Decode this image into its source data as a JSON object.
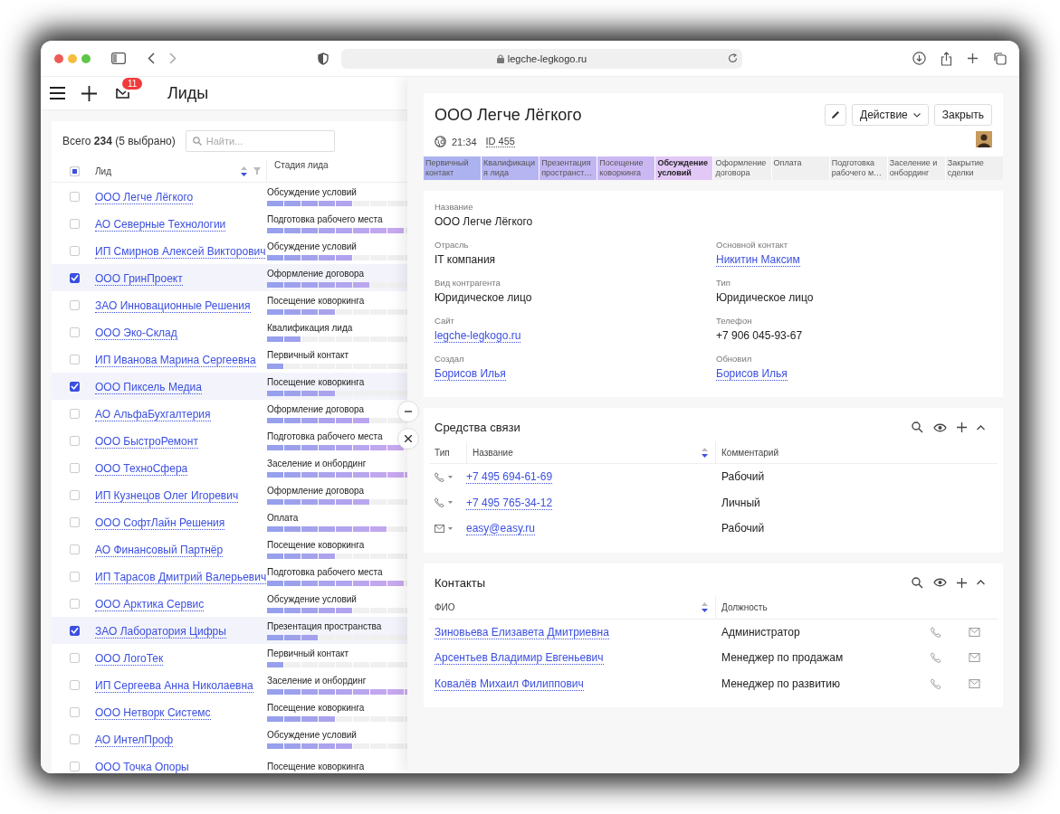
{
  "browser": {
    "url": "legche-legkogo.ru"
  },
  "app_bar": {
    "badge": "11",
    "title": "Лиды"
  },
  "leads": {
    "summary": "Всего **234** (5 выбрано)",
    "search_placeholder": "Найти...",
    "select_all_partial": true,
    "columns": [
      "Лид",
      "Стадия лида"
    ],
    "rows": [
      {
        "name": "ООО Легче Лёгкого",
        "stage": "Обсуждение условий",
        "level": 0.5,
        "selected": false
      },
      {
        "name": "АО Северные Технологии",
        "stage": "Подготовка рабочего места",
        "level": 0.8,
        "selected": false
      },
      {
        "name": "ИП Смирнов Алексей Викторович",
        "stage": "Обсуждение условий",
        "level": 0.5,
        "selected": false
      },
      {
        "name": "ООО ГринПроект",
        "stage": "Оформление договора",
        "level": 0.6,
        "selected": true
      },
      {
        "name": "ЗАО Инновационные Решения",
        "stage": "Посещение коворкинга",
        "level": 0.4,
        "selected": false
      },
      {
        "name": "ООО Эко-Склад",
        "stage": "Квалификация лида",
        "level": 0.2,
        "selected": false
      },
      {
        "name": "ИП Иванова Марина Сергеевна",
        "stage": "Первичный контакт",
        "level": 0.1,
        "selected": false
      },
      {
        "name": "ООО Пиксель Медиа",
        "stage": "Посещение коворкинга",
        "level": 0.4,
        "selected": true
      },
      {
        "name": "АО АльфаБухгалтерия",
        "stage": "Оформление договора",
        "level": 0.6,
        "selected": false
      },
      {
        "name": "ООО БыстроРемонт",
        "stage": "Подготовка рабочего места",
        "level": 0.8,
        "selected": false
      },
      {
        "name": "ООО ТехноСфера",
        "stage": "Заселение и онбординг",
        "level": 0.9,
        "selected": false
      },
      {
        "name": "ИП Кузнецов Олег Игоревич",
        "stage": "Оформление договора",
        "level": 0.6,
        "selected": false
      },
      {
        "name": "ООО СофтЛайн Решения",
        "stage": "Оплата",
        "level": 0.7,
        "selected": false
      },
      {
        "name": "АО Финансовый Партнёр",
        "stage": "Посещение коворкинга",
        "level": 0.4,
        "selected": false
      },
      {
        "name": "ИП Тарасов Дмитрий Валерьевич",
        "stage": "Подготовка рабочего места",
        "level": 0.8,
        "selected": false
      },
      {
        "name": "ООО Арктика Сервис",
        "stage": "Обсуждение условий",
        "level": 0.5,
        "selected": false
      },
      {
        "name": "ЗАО Лаборатория Цифры",
        "stage": "Презентация пространства",
        "level": 0.3,
        "selected": true
      },
      {
        "name": "ООО ЛогоТек",
        "stage": "Первичный контакт",
        "level": 0.1,
        "selected": false
      },
      {
        "name": "ИП Сергеева Анна Николаевна",
        "stage": "Заселение и онбординг",
        "level": 0.9,
        "selected": false
      },
      {
        "name": "ООО Нетворк Системс",
        "stage": "Посещение коворкинга",
        "level": 0.4,
        "selected": false
      },
      {
        "name": "АО ИнтелПроф",
        "stage": "Обсуждение условий",
        "level": 0.5,
        "selected": false
      },
      {
        "name": "ООО Точка Опоры",
        "stage": "Посещение коворкинга",
        "selected": false
      }
    ]
  },
  "lead": {
    "title": "ООО Легче Лёгкого",
    "time": "21:34",
    "id": "ID 455",
    "action_button": "Действие",
    "close_button": "Закрыть",
    "stages": [
      {
        "label": "Первичный контакт",
        "done": true,
        "selected": false
      },
      {
        "label": "Квалификация лида",
        "done": true,
        "selected": false
      },
      {
        "label": "Презентация пространст…",
        "done": true,
        "selected": false
      },
      {
        "label": "Посещение коворкинга",
        "done": true,
        "selected": false
      },
      {
        "label": "Обсуждение условий",
        "done": true,
        "selected": true
      },
      {
        "label": "Оформление договора",
        "done": false,
        "selected": false
      },
      {
        "label": "Оплата",
        "done": false,
        "selected": false
      },
      {
        "label": "Подготовка рабочего м…",
        "done": false,
        "selected": false
      },
      {
        "label": "Заселение и онбординг",
        "done": false,
        "selected": false
      },
      {
        "label": "Закрытие сделки",
        "done": false,
        "selected": false
      }
    ],
    "fields": [
      [
        {
          "label": "Название",
          "value": "ООО Легче Лёгкого",
          "kind": "text"
        }
      ],
      [
        {
          "label": "Отрасль",
          "value": "IT компания",
          "kind": "text"
        },
        {
          "label": "Основной контакт",
          "value": "Никитин Максим",
          "kind": "link"
        }
      ],
      [
        {
          "label": "Вид контрагента",
          "value": "Юридическое лицо",
          "kind": "text"
        },
        {
          "label": "Тип",
          "value": "Юридическое лицо",
          "kind": "text"
        }
      ],
      [
        {
          "label": "Сайт",
          "value": "legche-legkogo.ru",
          "kind": "link"
        },
        {
          "label": "Телефон",
          "value": "+7 906 045-93-67",
          "kind": "text"
        }
      ],
      [
        {
          "label": "Создал",
          "value": "Борисов Илья",
          "kind": "link"
        },
        {
          "label": "Обновил",
          "value": "Борисов Илья",
          "kind": "link"
        }
      ]
    ]
  },
  "channels": {
    "title": "Средства связи",
    "columns": [
      "Тип",
      "Название",
      "Комментарий"
    ],
    "rows": [
      {
        "kind": "phone",
        "value": "+7 495 694-61-69",
        "comment": "Рабочий"
      },
      {
        "kind": "phone",
        "value": "+7 495 765-34-12",
        "comment": "Личный"
      },
      {
        "kind": "email",
        "value": "easy@easy.ru",
        "comment": "Рабочий"
      }
    ]
  },
  "contacts": {
    "title": "Контакты",
    "columns": [
      "ФИО",
      "Должность"
    ],
    "rows": [
      {
        "name": "Зиновьева Елизавета Дмитриевна",
        "position": "Администратор"
      },
      {
        "name": "Арсентьев Владимир Евгеньевич",
        "position": "Менеджер по продажам"
      },
      {
        "name": "Ковалёв Михаил Филиппович",
        "position": "Менеджер по развитию"
      }
    ]
  }
}
